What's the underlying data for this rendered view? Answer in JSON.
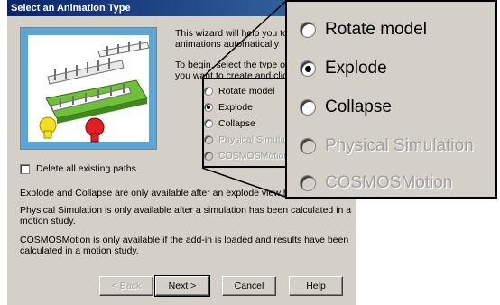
{
  "dialog": {
    "title": "Select an Animation Type",
    "intro_line1": "This wizard will help you to cre",
    "intro_line2": "animations automatically",
    "intro_line3": "To begin, select the type of an",
    "intro_line4": "you want to create and click N",
    "options": [
      {
        "label": "Rotate model",
        "selected": false,
        "disabled": false
      },
      {
        "label": "Explode",
        "selected": true,
        "disabled": false
      },
      {
        "label": "Collapse",
        "selected": false,
        "disabled": false
      },
      {
        "label": "Physical Simulation",
        "selected": false,
        "disabled": true
      },
      {
        "label": "COSMOSMotion",
        "selected": false,
        "disabled": true
      }
    ],
    "checkbox_label": "Delete all existing paths",
    "checkbox_checked": false,
    "note1": "Explode and Collapse are only available after an explode view has bee",
    "note2": "Physical Simulation is only available after a simulation has been calculated in a motion study.",
    "note3": "COSMOSMotion is only available if the add-in is loaded and results have been calculated in a motion study.",
    "buttons": {
      "back": "< Back",
      "next": "Next >",
      "cancel": "Cancel",
      "help": "Help"
    }
  },
  "callout": {
    "options": [
      "Rotate model",
      "Explode",
      "Collapse",
      "Physical Simulation",
      "COSMOSMotion"
    ]
  },
  "colors": {
    "titlebar_start": "#0a246a",
    "titlebar_end": "#3a6ea5",
    "dialog_bg": "#d4d0c8",
    "illus_plate": "#6fbf3a",
    "illus_red": "#e02020",
    "illus_yellow": "#f0e020"
  },
  "icons": [
    "radio-button",
    "checkbox",
    "assembly-illustration"
  ]
}
